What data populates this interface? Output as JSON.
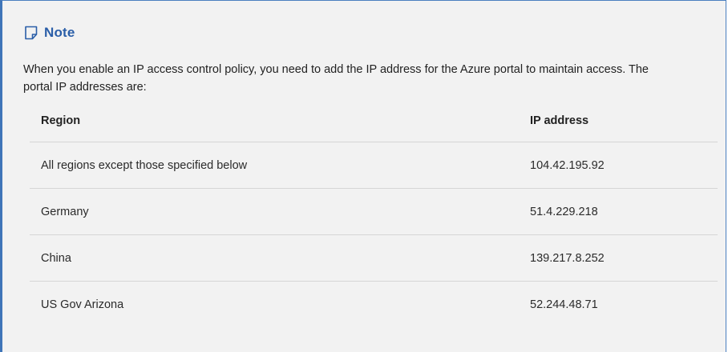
{
  "note": {
    "icon": "note-icon",
    "title": "Note",
    "body": "When you enable an IP access control policy, you need to add the IP address for the Azure portal to maintain access. The portal IP addresses are:",
    "accent_color": "#2a5ea8",
    "border_color": "#3f75b8"
  },
  "table": {
    "headers": [
      "Region",
      "IP address"
    ],
    "rows": [
      {
        "region": "All regions except those specified below",
        "ip": "104.42.195.92"
      },
      {
        "region": "Germany",
        "ip": "51.4.229.218"
      },
      {
        "region": "China",
        "ip": "139.217.8.252"
      },
      {
        "region": "US Gov Arizona",
        "ip": "52.244.48.71"
      }
    ]
  }
}
